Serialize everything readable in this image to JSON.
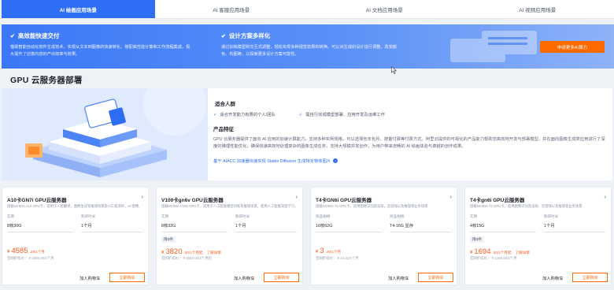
{
  "tabs": [
    "AI 绘画应用场景",
    "AI 客服应用场景",
    "AI 文档应用场景",
    "AI 视频应用场景"
  ],
  "banner": {
    "left_title": "高效能快速交付",
    "left_desc": "借助智能自动化软件生成技术，实现从文本到图像的快速转化，搭配高性能计算和工作流程集成，极大提升了创意内容的产出效率与效果。",
    "right_title": "设计方案多样化",
    "right_desc": "通过训练模型和交互式调整，轻松实现多种视觉效果的转换。可以对生成的设计进行调整，改变颜色、构图等，以探索更多设计方案可能性。",
    "cta": "申请更多AI算力"
  },
  "section_title": "GPU 云服务器部署",
  "feature": {
    "fit_title": "适合人群",
    "fit_items": [
      "适合开发能力有限的个人/团队",
      "需自行完成模型部署、应用开发及运维工作"
    ],
    "char_title": "产品特征",
    "char_desc": "GPU 云服务器提供了面向 AI 应用的加速计算能力，支持多种实例规格，可以选择包年包月、按量付费等付费方式。阿里云提供的可视化的产品能力帮助您高效地开发与部署模型，并在面向图像生成类应用进行了深度的推理性能优化，确保快速高效地处理复杂的图像生成任务，支持大规模并发创作，为用户带来流畅的 AI 绘画体验与卓越的创作成果。",
    "link_text": "基于 AIACC 加速器快速实现 Stable Diffusion 生成特定物体图片",
    "link_icon": "arrow-right"
  },
  "cards": [
    {
      "title": "A10卡GN7i GPU云服务器",
      "subtitle": "搭载NVIDIA A10 GPU卡，适用于人脸翻译，图像生成等推理场景及AI工程项目，AI 图像、科学",
      "badge": "",
      "label1": "实例",
      "value1": "8核30G",
      "label2": "购买时长",
      "value2": "1个月",
      "currency": "¥",
      "price": "4585",
      "unit": ".28/1个月",
      "promo": "",
      "orig": "官网折扣价： ¥ 4585.00/1个月",
      "cart": "加入购物车",
      "buy": "立即购买"
    },
    {
      "title": "V100卡gn6v GPU云服务器",
      "subtitle": "搭载NVIDIA V100 GPU卡，适用于人工智能模型训练及推理场景，使用人工智能深度学习，科学计算",
      "badge": "限5件",
      "label1": "实例",
      "value1": "8核32G",
      "label2": "购买时长",
      "value2": "1个月",
      "currency": "¥",
      "price": "3820",
      "unit": ".00/1个月起",
      "promo": "了解详情",
      "orig": "官网折扣价： ¥ 4582.00/1个月起",
      "cart": "加入购物车",
      "buy": "立即购买"
    },
    {
      "title": "T4卡GN6i GPU云服务器",
      "subtitle": "搭载NVIDIA T4 GPU卡，适用图像识别及渲染，云游戏以及推理等业务场景",
      "badge": "",
      "label1": "商品规格",
      "value1": "16核62G",
      "label2": "商品规格",
      "value2": "T4-16G 显存",
      "currency": "¥",
      "price": "3",
      "unit": ".00/1个月",
      "promo": "",
      "orig": "官网折扣价： ¥ 10.41/1个月",
      "cart": "加入购物车",
      "buy": "立即购买"
    },
    {
      "title": "T4卡gn6i GPU云服务器",
      "subtitle": "搭载NVIDIA T4 GPU卡，适用图像识别及渲染，云游戏以及推理等业务场景",
      "badge": "限5件",
      "label1": "实例",
      "value1": "4核15G",
      "label2": "购买时长",
      "value2": "1个月",
      "currency": "¥",
      "price": "1694",
      "unit": ".00/1个月起",
      "promo": "了解详情",
      "orig": "官网折扣价： ¥ 1368.00/1个月",
      "cart": "加入购物车",
      "buy": "立即购买"
    }
  ],
  "colors": {
    "primary": "#2e6ef5",
    "accent": "#ff6a00",
    "price": "#ff5a1f"
  }
}
